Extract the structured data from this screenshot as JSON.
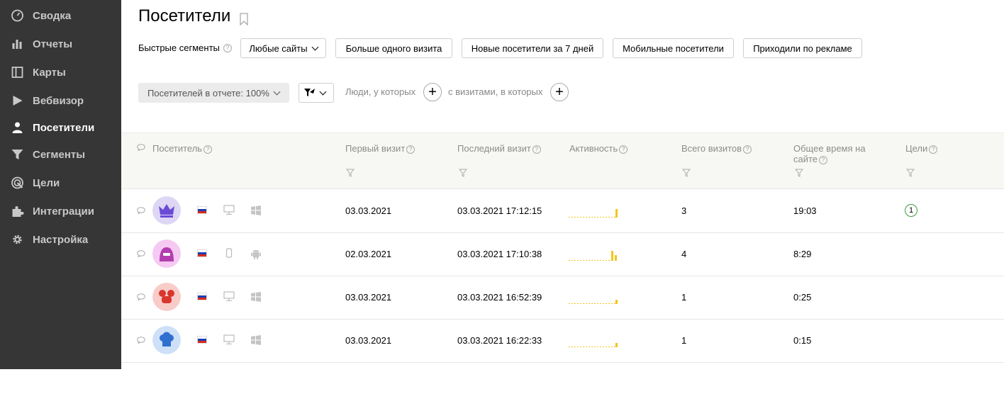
{
  "sidebar": {
    "items": [
      {
        "label": "Сводка",
        "icon": "gauge-icon",
        "active": false
      },
      {
        "label": "Отчеты",
        "icon": "bar-chart-icon",
        "active": false
      },
      {
        "label": "Карты",
        "icon": "map-icon",
        "active": false
      },
      {
        "label": "Вебвизор",
        "icon": "play-icon",
        "active": false
      },
      {
        "label": "Посетители",
        "icon": "person-icon",
        "active": true
      },
      {
        "label": "Сегменты",
        "icon": "funnel-icon",
        "active": false
      },
      {
        "label": "Цели",
        "icon": "target-icon",
        "active": false
      },
      {
        "label": "Интеграции",
        "icon": "puzzle-icon",
        "active": false
      },
      {
        "label": "Настройка",
        "icon": "gear-icon",
        "active": false
      }
    ]
  },
  "header": {
    "title": "Посетители",
    "quick_segments_label": "Быстрые сегменты",
    "segments": [
      "Любые сайты",
      "Больше одного визита",
      "Новые посетители за 7 дней",
      "Мобильные посетители",
      "Приходили по рекламе"
    ]
  },
  "filters": {
    "sample": "Посетителей в отчете: 100%",
    "people_label": "Люди, у которых",
    "visits_label": "с визитами, в которых"
  },
  "table": {
    "columns": [
      "Посетитель",
      "Первый визит",
      "Последний визит",
      "Активность",
      "Всего визитов",
      "Общее время на сайте",
      "Цели"
    ],
    "rows": [
      {
        "avatar": "crown-avatar-icon",
        "avatar_bg": "#ddd6f5",
        "avatar_fg": "#6b4bd6",
        "device": "desktop-icon",
        "os": "windows-icon",
        "first_visit": "03.03.2021",
        "last_visit": "03.03.2021 17:12:15",
        "visits": "3",
        "time": "19:03",
        "goals": "1"
      },
      {
        "avatar": "hooded-figure-avatar-icon",
        "avatar_bg": "#f5c9f2",
        "avatar_fg": "#b23db0",
        "device": "mobile-icon",
        "os": "android-icon",
        "first_visit": "02.03.2021",
        "last_visit": "03.03.2021 17:10:38",
        "visits": "4",
        "time": "8:29",
        "goals": ""
      },
      {
        "avatar": "mouse-ears-avatar-icon",
        "avatar_bg": "#f7ccc9",
        "avatar_fg": "#d9362e",
        "device": "desktop-icon",
        "os": "windows-icon",
        "first_visit": "03.03.2021",
        "last_visit": "03.03.2021 16:52:39",
        "visits": "1",
        "time": "0:25",
        "goals": ""
      },
      {
        "avatar": "chef-hat-avatar-icon",
        "avatar_bg": "#cde0f7",
        "avatar_fg": "#2f6fd0",
        "device": "desktop-icon",
        "os": "windows-icon",
        "first_visit": "03.03.2021",
        "last_visit": "03.03.2021 16:22:33",
        "visits": "1",
        "time": "0:15",
        "goals": ""
      }
    ]
  },
  "colors": {
    "sidebar_bg": "#363636",
    "activity_bar": "#f5c518",
    "goal_ring": "#3f9a3f"
  }
}
